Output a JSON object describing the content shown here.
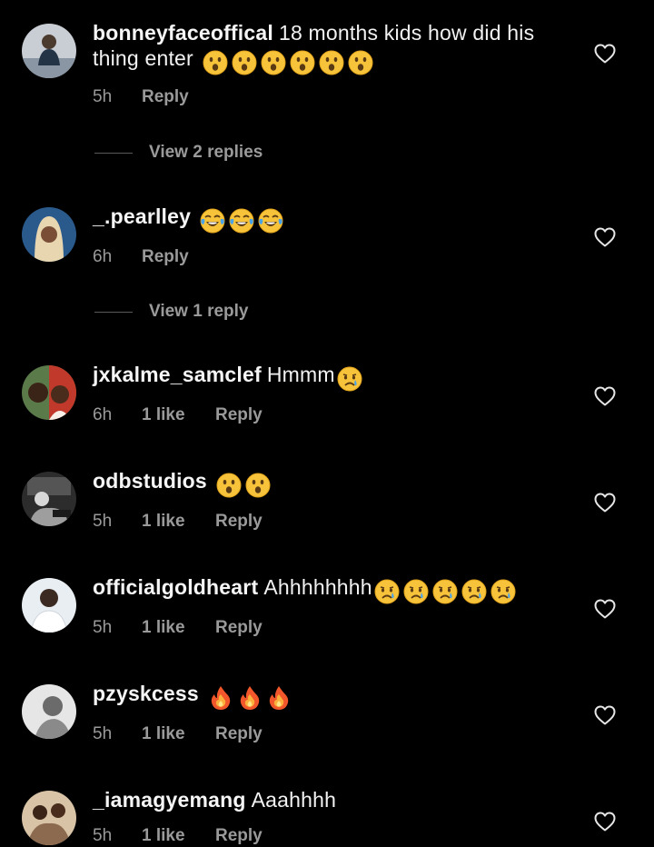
{
  "comments": [
    {
      "username": "bonneyfaceoffical",
      "text_line1": "18 months kids how did his",
      "text_line2": "thing enter",
      "emojis": [
        "hushed-face-emoji",
        "hushed-face-emoji",
        "hushed-face-emoji",
        "hushed-face-emoji",
        "hushed-face-emoji",
        "hushed-face-emoji"
      ],
      "time": "5h",
      "likes": "",
      "reply_label": "Reply",
      "avatar_colors": [
        "#3b4a5a",
        "#c9cdd4"
      ]
    },
    {
      "username": "_.pearlley",
      "text": "",
      "emojis": [
        "face-with-tears-of-joy-emoji",
        "face-with-tears-of-joy-emoji",
        "face-with-tears-of-joy-emoji"
      ],
      "time": "6h",
      "likes": "",
      "reply_label": "Reply",
      "avatar_colors": [
        "#2a5a8c",
        "#e8d6b0"
      ]
    },
    {
      "username": "jxkalme_samclef",
      "text": "Hmmm",
      "emojis": [
        "crying-face-emoji"
      ],
      "time": "6h",
      "likes": "1 like",
      "reply_label": "Reply",
      "avatar_colors": [
        "#5b7a4a",
        "#c0392b"
      ]
    },
    {
      "username": "odbstudios",
      "text": "",
      "emojis": [
        "hushed-face-emoji",
        "hushed-face-emoji"
      ],
      "time": "5h",
      "likes": "1 like",
      "reply_label": "Reply",
      "avatar_colors": [
        "#2c2c2c",
        "#9e9e9e"
      ]
    },
    {
      "username": "officialgoldheart",
      "text": "Ahhhhhhhh",
      "emojis": [
        "crying-face-emoji",
        "crying-face-emoji",
        "crying-face-emoji",
        "crying-face-emoji",
        "crying-face-emoji"
      ],
      "time": "5h",
      "likes": "1 like",
      "reply_label": "Reply",
      "avatar_colors": [
        "#e9eef2",
        "#3b2a22"
      ]
    },
    {
      "username": "pzyskcess",
      "text": "",
      "emojis": [
        "fire-emoji",
        "fire-emoji",
        "fire-emoji"
      ],
      "time": "5h",
      "likes": "1 like",
      "reply_label": "Reply",
      "avatar_colors": [
        "#e6e6e6",
        "#6b6b6b"
      ]
    },
    {
      "username": "_iamagyemang",
      "text": "Aaahhhh",
      "emojis": [],
      "time": "5h",
      "likes": "1 like",
      "reply_label": "Reply",
      "avatar_colors": [
        "#8c6a4f",
        "#d9c3a6"
      ]
    }
  ],
  "view_replies": [
    {
      "label": "View 2 replies"
    },
    {
      "label": "View 1 reply"
    }
  ],
  "colors": {
    "background": "#000000",
    "primary_text": "#f5f5f5",
    "secondary_text": "#9a9a9a"
  }
}
